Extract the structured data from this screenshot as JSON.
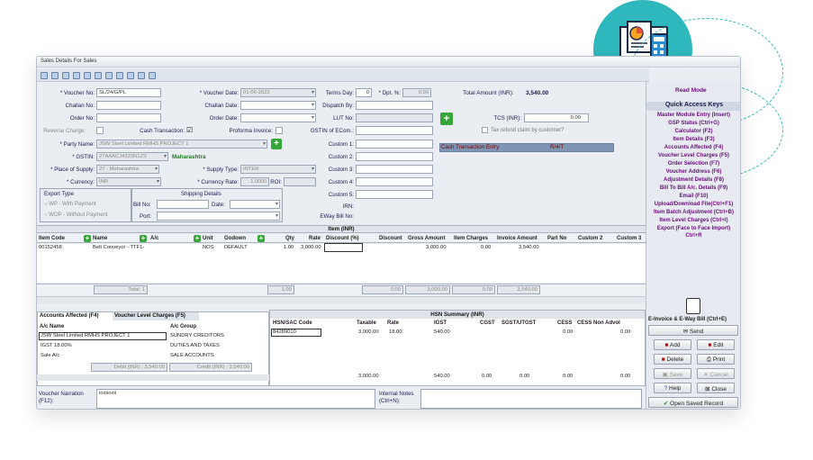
{
  "window": {
    "title": "Sales Details For Sales"
  },
  "header": {
    "voucher_no_label": "* Voucher No:",
    "voucher_no": "SL/24/G/PL",
    "voucher_date_label": "* Voucher Date:",
    "voucher_date": "01-06-2022",
    "challan_no_label": "Challan No:",
    "challan_no": "",
    "challan_date_label": "Challan Date:",
    "challan_date": "",
    "order_no_label": "Order No:",
    "order_no": "",
    "order_date_label": "Order Date:",
    "order_date": "",
    "reverse_charge_label": "Reverse Charge:",
    "cash_transaction_label": "Cash Transaction:",
    "cash_transaction_check": "☑",
    "proforma_invoice_label": "Proforma Invoice:",
    "party_name_label": "* Party Name:",
    "party_name": "JSW Steel Limited RMHS PROJECT 1",
    "gstin_label": "* GSTIN:",
    "gstin": "27AAACJ4323N1ZS",
    "state": "Maharashtra",
    "place_of_supply_label": "* Place of Supply:",
    "place_of_supply": "27 - Maharashtra",
    "supply_type_label": "* Supply Type:",
    "supply_type": "INTER",
    "currency_label": "* Currency:",
    "currency": "INR",
    "currency_rate_label": "* Currency Rate:",
    "currency_rate": "1.0000",
    "roi_label": "ROI:",
    "export_type_title": "Export Type",
    "wp_label": "WP - With Payment",
    "wop_label": "WOP - Without Payment",
    "shipping_title": "Shipping Details",
    "bill_no_label": "Bill No:",
    "date_label": "Date:",
    "port_label": "Port:",
    "terms_day_label": "Terms Day:",
    "terms_day": "0",
    "dpt_label": "* Dpt. %:",
    "dpt": "0.00",
    "total_amount_label": "Total Amount (INR):",
    "total_amount": "3,540.00",
    "dispatch_by_label": "Dispatch By:",
    "lut_no_label": "LUT No:",
    "gstin_ecom_label": "GSTIN of ECom.:",
    "custom1_label": "Custom 1:",
    "custom2_label": "Custom 2:",
    "custom3_label": "Custom 3:",
    "custom4_label": "Custom 4:",
    "custom5_label": "Custom 5:",
    "irn_label": "IRN:",
    "eway_label": "EWay Bill No:",
    "tcs_label": "TCS (INR):",
    "tcs": "0.00",
    "tax_refund_label": "Tax refund claim by customer?",
    "cash_entry_label": "Cash Transaction Entry",
    "cash_entry_value": "R/4/T"
  },
  "items": {
    "title": "Item (INR)",
    "columns": [
      "Item Code",
      "Name",
      "A/c",
      "Unit",
      "Godown",
      "Qty",
      "Rate",
      "Discount (%)",
      "Discount",
      "Gross Amount",
      "Item Charges",
      "Invoice Amount",
      "Part No",
      "Custom 2",
      "Custom 3"
    ],
    "row": {
      "code": "00152458",
      "name": "Belt Conveyor - TTF1-",
      "unit": "NOS",
      "godown": "DEFAULT",
      "qty": "1.00",
      "rate": "3,000.00",
      "gross": "3,000.00",
      "charges": "0.00",
      "invoice": "3,540.00"
    },
    "total_label": "Total: 1",
    "total_qty": "1.00",
    "total_discount": "0.00",
    "total_gross": "3,000.00",
    "total_charges": "0.00",
    "total_invoice": "3,540.00"
  },
  "accounts": {
    "tab1": "Accounts Affected (F4)",
    "tab2": "Voucher Level Charges (F5)",
    "col_name": "A/c Name",
    "col_group": "A/c Group",
    "rows": [
      {
        "name": "JSW Steel Limited RMHS PROJECT 1",
        "group": "SUNDRY CREDITORS"
      },
      {
        "name": "IGST 18.00%",
        "group": "DUTIES AND TAXES"
      },
      {
        "name": "Sale A/c",
        "group": "SALE ACCOUNTS"
      }
    ],
    "debit": "Debit (INR) : 3,540.00",
    "credit": "Credit (INR) : 3,540.00"
  },
  "hsn": {
    "title": "HSN Summary (INR)",
    "columns": [
      "HSN/SAC Code",
      "Taxable",
      "Rate",
      "IGST",
      "CGST",
      "SGST/UTGST",
      "CESS",
      "CESS Non Advol"
    ],
    "row": {
      "code": "84289010",
      "taxable": "3,000.00",
      "rate": "18.00",
      "igst": "540.00",
      "cess": "0.00",
      "cess_non": "0.00"
    },
    "total": {
      "taxable": "3,000.00",
      "igst": "540.00",
      "cgst": "0.00",
      "sgst": "0.00",
      "cess": "0.00",
      "cess_non": "0.00"
    }
  },
  "footer": {
    "narration_label": "Voucher Narration\n(F12):",
    "narration": "ioioioioi",
    "notes_label": "Internal Notes\n(Ctrl+N):"
  },
  "panel": {
    "read_mode": "Read Mode",
    "quick_title": "Quick Access Keys",
    "keys": [
      "Master Module Entry (Insert)",
      "GSP Status (Ctrl+G)",
      "Calculator (F2)",
      "Item Details (F3)",
      "Accounts Affected (F4)",
      "Voucher Level Charges (F5)",
      "Order Selection (F7)",
      "Voucher Address (F6)",
      "Adjustment Details (F8)",
      "Bill To Bill A/c. Details (F9)",
      "Email (F10)",
      "Upload/Download File(Ctrl+F1)",
      "Item Batch Adjustment (Ctrl+B)",
      "Item Level Charges (Ctrl+I)",
      "Export (Face to Face Import)",
      "Ctrl+R"
    ],
    "einvoice": "E-Invoice & E-Way Bill (Ctrl+E)",
    "send": "Send",
    "add": "Add",
    "edit": "Edit",
    "delete": "Delete",
    "print": "Print",
    "save": "Save",
    "cancel": "Cancel",
    "help": "Help",
    "close": "Close",
    "open_saved": "Open Saved Record"
  },
  "colors": {
    "accent": "#2fb7be",
    "quick_text": "#6a0d7a",
    "green": "#37a53a"
  }
}
